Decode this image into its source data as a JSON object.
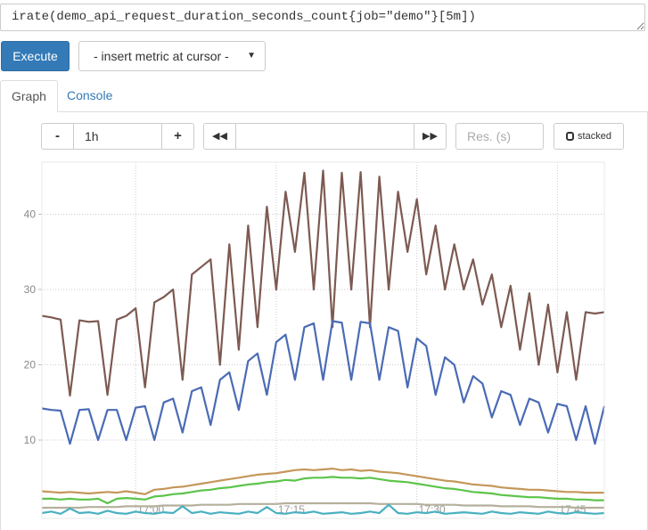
{
  "query": {
    "expression": "irate(demo_api_request_duration_seconds_count{job=\"demo\"}[5m])"
  },
  "toolbar": {
    "execute_label": "Execute",
    "metric_select": "- insert metric at cursor -"
  },
  "tabs": [
    {
      "label": "Graph",
      "active": true
    },
    {
      "label": "Console",
      "active": false
    }
  ],
  "controls": {
    "range_minus": "-",
    "range_value": "1h",
    "range_plus": "+",
    "back_icon": "double-left-arrow",
    "forward_icon": "double-right-arrow",
    "end_time": "",
    "resolution_placeholder": "Res. (s)",
    "stacked_label": "stacked"
  },
  "chart_data": {
    "type": "line",
    "ylim": [
      0,
      47
    ],
    "yticks": [
      10,
      20,
      30,
      40
    ],
    "xlim": [
      "16:50",
      "17:50"
    ],
    "xticks": [
      "17:00",
      "17:15",
      "17:30",
      "17:45"
    ],
    "grid": true,
    "x_step_minutes": 1,
    "series": [
      {
        "color": "#7d5a52",
        "values": [
          26.5,
          26.3,
          26,
          15.9,
          25.9,
          25.7,
          25.8,
          16,
          26,
          26.5,
          27.5,
          17,
          28.3,
          29,
          30,
          18,
          32,
          33,
          34,
          20,
          36,
          22,
          38.5,
          25,
          41,
          30,
          43,
          35,
          45.5,
          30,
          45.8,
          25,
          45.5,
          30,
          45.6,
          25,
          45,
          30,
          43,
          35,
          42,
          32,
          38.5,
          30,
          36,
          30,
          34,
          28,
          32,
          25,
          30.5,
          22,
          29.5,
          20,
          28,
          19,
          27,
          18,
          27,
          26.8,
          27
        ]
      },
      {
        "color": "#4a6bb5",
        "values": [
          14.2,
          14,
          13.9,
          9.5,
          14,
          14.1,
          10,
          14,
          14,
          10,
          14.3,
          14.5,
          10,
          15,
          15.5,
          11,
          16.5,
          17,
          12,
          18,
          19,
          14,
          20.5,
          21.5,
          16,
          23,
          24,
          18,
          25,
          25.5,
          18,
          25.8,
          25.6,
          18,
          25.7,
          25.5,
          18,
          25,
          24.5,
          17,
          23.5,
          22.5,
          16,
          21,
          20,
          15,
          18.5,
          17.5,
          13,
          16.5,
          16,
          12,
          15.5,
          15,
          11,
          14.8,
          14.5,
          10,
          14.5,
          9.5,
          14.5
        ]
      },
      {
        "color": "#c4975a",
        "values": [
          3.2,
          3.1,
          3,
          3.1,
          3,
          2.9,
          3,
          3.1,
          3,
          3.2,
          3,
          2.8,
          3.4,
          3.5,
          3.7,
          3.8,
          4,
          4.2,
          4.4,
          4.6,
          4.8,
          5,
          5.2,
          5.4,
          5.5,
          5.6,
          5.8,
          6,
          6.1,
          6,
          6.1,
          6.2,
          6,
          6.1,
          5.9,
          6,
          5.8,
          5.7,
          5.6,
          5.4,
          5.2,
          5,
          4.8,
          4.6,
          4.5,
          4.3,
          4.1,
          4,
          3.9,
          3.7,
          3.6,
          3.5,
          3.4,
          3.4,
          3.3,
          3.2,
          3.1,
          3.1,
          3,
          3,
          3
        ]
      },
      {
        "color": "#5cc44a",
        "values": [
          2.2,
          2.2,
          2.1,
          2.2,
          2.1,
          2.1,
          2.2,
          1.6,
          2.2,
          2.3,
          2.2,
          2.1,
          2.5,
          2.6,
          2.8,
          2.9,
          3.1,
          3.3,
          3.4,
          3.6,
          3.7,
          3.9,
          4.1,
          4.2,
          4.4,
          4.5,
          4.7,
          4.6,
          4.9,
          5,
          5,
          5.1,
          5,
          5,
          4.9,
          5,
          4.8,
          4.6,
          4.5,
          4.4,
          4.2,
          4,
          3.8,
          3.6,
          3.5,
          3.3,
          3.1,
          3,
          2.9,
          2.7,
          2.6,
          2.5,
          2.4,
          2.4,
          2.3,
          2.2,
          2.2,
          2.1,
          2.1,
          2,
          2
        ]
      },
      {
        "color": "#b5b09c",
        "values": [
          1,
          1,
          1,
          1,
          1,
          1.1,
          1.1,
          1.1,
          1.1,
          1.2,
          1.2,
          1.2,
          1.2,
          1.3,
          1.3,
          1.3,
          1.3,
          1.4,
          1.4,
          1.4,
          1.4,
          1.5,
          1.5,
          1.5,
          1.5,
          1.5,
          1.6,
          1.6,
          1.6,
          1.6,
          1.6,
          1.6,
          1.6,
          1.6,
          1.6,
          1.6,
          1.5,
          1.5,
          1.5,
          1.5,
          1.5,
          1.4,
          1.4,
          1.4,
          1.4,
          1.3,
          1.3,
          1.3,
          1.3,
          1.2,
          1.2,
          1.2,
          1.2,
          1.1,
          1.1,
          1.1,
          1.1,
          1,
          1,
          1,
          1
        ]
      },
      {
        "color": "#4ab0c0",
        "values": [
          0.3,
          0.5,
          0.2,
          0.9,
          0.3,
          0.4,
          0.2,
          0.6,
          0.3,
          0.2,
          0.5,
          0.3,
          0.2,
          0.4,
          0.3,
          1.2,
          0.3,
          0.5,
          0.2,
          0.4,
          0.3,
          0.2,
          0.5,
          0.3,
          1.1,
          0.3,
          0.2,
          0.4,
          0.3,
          0.5,
          0.2,
          0.3,
          0.4,
          0.2,
          0.3,
          0.5,
          0.3,
          1.4,
          0.3,
          0.2,
          0.4,
          0.3,
          0.5,
          0.2,
          0.3,
          0.4,
          0.3,
          0.2,
          0.5,
          0.3,
          0.2,
          0.4,
          0.3,
          0.2,
          0.5,
          0.3,
          0.2,
          0.4,
          0.3,
          0.2,
          0.3
        ]
      }
    ]
  }
}
